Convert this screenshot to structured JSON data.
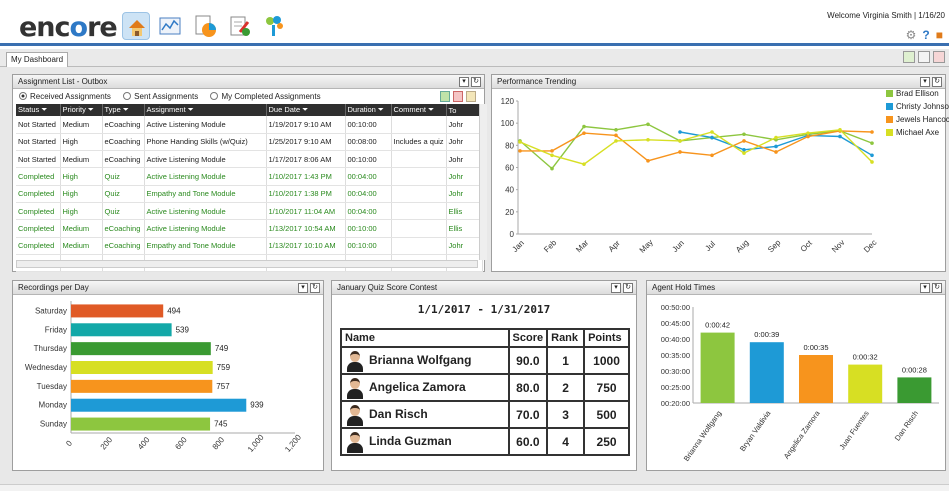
{
  "app": {
    "logo_text_1": "enc",
    "logo_text_2": "o",
    "logo_text_3": "re",
    "welcome": "Welcome Virginia Smith | 1/16/20"
  },
  "nav_icons": [
    "home-icon",
    "dashboard-icon",
    "reports-icon",
    "evaluations-icon",
    "settings-icon"
  ],
  "tools": [
    "gear-icon",
    "help-icon",
    "logout-icon"
  ],
  "tab": {
    "label": "My Dashboard"
  },
  "assignments": {
    "title": "Assignment List - Outbox",
    "radio_received": "Received Assignments",
    "radio_sent": "Sent Assignments",
    "radio_completed": "My Completed Assignments",
    "columns": [
      "Status",
      "Priority",
      "Type",
      "Assignment",
      "Due Date",
      "Duration",
      "Comment",
      "To"
    ],
    "rows": [
      {
        "status": "Not Started",
        "priority": "Medium",
        "type": "eCoaching",
        "assignment": "Active Listening Module",
        "due": "1/19/2017 9:10 AM",
        "duration": "00:10:00",
        "comment": "",
        "to": "Johr"
      },
      {
        "status": "Not Started",
        "priority": "High",
        "type": "eCoaching",
        "assignment": "Phone Handing Skills (w/Quiz)",
        "due": "1/25/2017 9:10 AM",
        "duration": "00:08:00",
        "comment": "Includes a quiz",
        "to": "Johr"
      },
      {
        "status": "Not Started",
        "priority": "Medium",
        "type": "eCoaching",
        "assignment": "Active Listening Module",
        "due": "1/17/2017 8:06 AM",
        "duration": "00:10:00",
        "comment": "",
        "to": "Johr"
      },
      {
        "status": "Completed",
        "priority": "High",
        "type": "Quiz",
        "assignment": "Active Listening Module",
        "due": "1/10/2017 1:43 PM",
        "duration": "00:04:00",
        "comment": "",
        "to": "Johr"
      },
      {
        "status": "Completed",
        "priority": "High",
        "type": "Quiz",
        "assignment": "Empathy and Tone Module",
        "due": "1/10/2017 1:38 PM",
        "duration": "00:04:00",
        "comment": "",
        "to": "Johr"
      },
      {
        "status": "Completed",
        "priority": "High",
        "type": "Quiz",
        "assignment": "Active Listening Module",
        "due": "1/10/2017 11:04 AM",
        "duration": "00:04:00",
        "comment": "",
        "to": "Ellis"
      },
      {
        "status": "Completed",
        "priority": "Medium",
        "type": "eCoaching",
        "assignment": "Active Listening Module",
        "due": "1/13/2017 10:54 AM",
        "duration": "00:10:00",
        "comment": "",
        "to": "Ellis"
      },
      {
        "status": "Completed",
        "priority": "Medium",
        "type": "eCoaching",
        "assignment": "Empathy and Tone Module",
        "due": "1/13/2017 10:10 AM",
        "duration": "00:10:00",
        "comment": "",
        "to": "Johr"
      },
      {
        "status": "Completed",
        "priority": "Medium",
        "type": "eCoaching",
        "assignment": "Active Listening Module",
        "due": "1/13/2017 10:09 AM",
        "duration": "00:10:00",
        "comment": "",
        "to": "Johr"
      }
    ]
  },
  "performance": {
    "title": "Performance Trending"
  },
  "recordings": {
    "title": "Recordings per Day"
  },
  "quiz": {
    "title": "January Quiz Score Contest",
    "date_range": "1/1/2017 - 1/31/2017",
    "headers": [
      "Name",
      "Score",
      "Rank",
      "Points"
    ],
    "rows": [
      {
        "name": "Brianna Wolfgang",
        "score": "90.0",
        "rank": "1",
        "points": "1000"
      },
      {
        "name": "Angelica Zamora",
        "score": "80.0",
        "rank": "2",
        "points": "750"
      },
      {
        "name": "Dan Risch",
        "score": "70.0",
        "rank": "3",
        "points": "500"
      },
      {
        "name": "Linda Guzman",
        "score": "60.0",
        "rank": "4",
        "points": "250"
      }
    ]
  },
  "hold": {
    "title": "Agent Hold Times"
  },
  "chart_data": [
    {
      "type": "line",
      "title": "",
      "x": [
        "Jan",
        "Feb",
        "Mar",
        "Apr",
        "May",
        "Jun",
        "Jul",
        "Aug",
        "Sep",
        "Oct",
        "Nov",
        "Dec"
      ],
      "ylim": [
        0,
        120
      ],
      "yticks": [
        0,
        20,
        40,
        60,
        80,
        100,
        120
      ],
      "series": [
        {
          "name": "Brad Ellison",
          "color": "#8dc63f",
          "values": [
            84,
            59,
            97,
            94,
            99,
            84,
            87,
            90,
            85,
            90,
            93,
            82
          ]
        },
        {
          "name": "Christy Johnson",
          "color": "#1e9ad6",
          "values": [
            null,
            null,
            null,
            null,
            null,
            92,
            87,
            76,
            79,
            89,
            88,
            71
          ]
        },
        {
          "name": "Jewels Hancock",
          "color": "#f7941d",
          "values": [
            75,
            75,
            91,
            89,
            66,
            74,
            71,
            84,
            74,
            88,
            93,
            92
          ]
        },
        {
          "name": "Michael Axe",
          "color": "#d7df23",
          "values": [
            83,
            71,
            63,
            84,
            85,
            84,
            92,
            73,
            87,
            91,
            94,
            65
          ]
        }
      ],
      "legend": "right",
      "grid": false
    },
    {
      "type": "bar",
      "orientation": "horizontal",
      "categories": [
        "Saturday",
        "Friday",
        "Thursday",
        "Wednesday",
        "Tuesday",
        "Monday",
        "Sunday"
      ],
      "values": [
        494,
        539,
        749,
        759,
        757,
        939,
        745
      ],
      "colors": [
        "#e05a26",
        "#13a8a8",
        "#3a9a32",
        "#d7df23",
        "#f7941d",
        "#1e9ad6",
        "#8dc63f"
      ],
      "xlim": [
        0,
        1200
      ],
      "xticks": [
        "0",
        "200",
        "400",
        "600",
        "800",
        "1,000",
        "1,200"
      ]
    },
    {
      "type": "bar",
      "categories": [
        "Brianna Wolfgang",
        "Bryan Valdivia",
        "Angelica Zamora",
        "Juan Fuentes",
        "Dan Risch"
      ],
      "values_seconds": [
        42,
        39,
        35,
        32,
        28
      ],
      "labels": [
        "0:00:42",
        "0:00:39",
        "0:00:35",
        "0:00:32",
        "0:00:28"
      ],
      "colors": [
        "#8dc63f",
        "#1e9ad6",
        "#f7941d",
        "#d7df23",
        "#3a9a32"
      ],
      "ylim_seconds": [
        20,
        50
      ],
      "yticks": [
        "00:20:00",
        "00:25:00",
        "00:30:00",
        "00:35:00",
        "00:40:00",
        "00:45:00",
        "00:50:00"
      ]
    }
  ]
}
